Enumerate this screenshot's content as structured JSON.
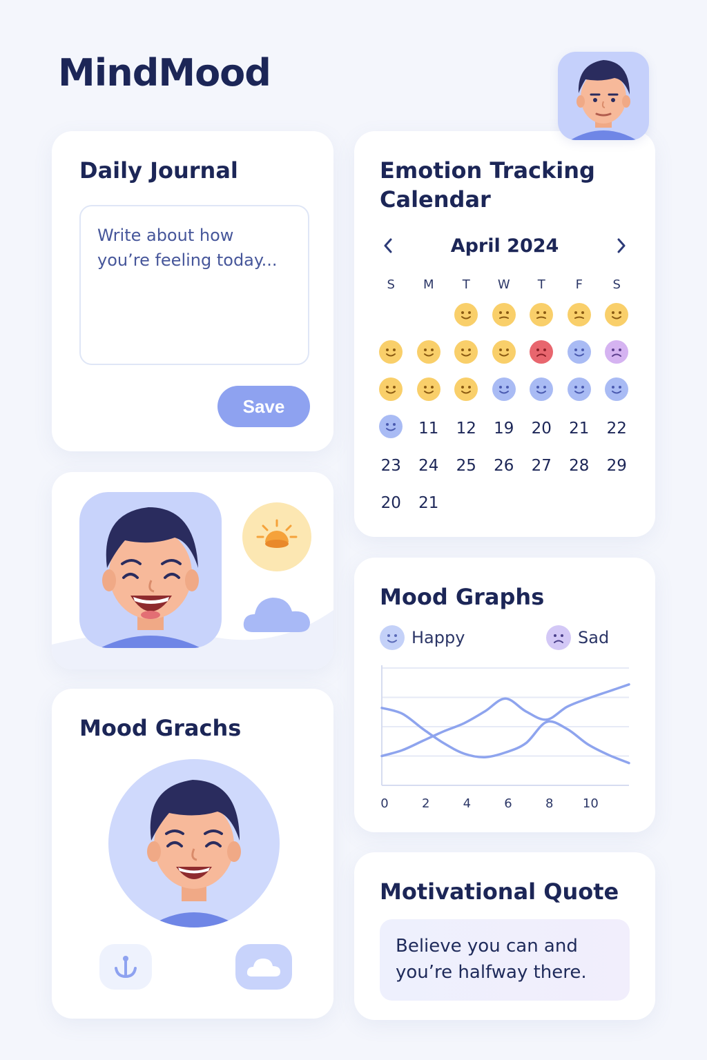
{
  "app": {
    "title": "MindMood"
  },
  "journal": {
    "title": "Daily Journal",
    "placeholder": "Write about how you’re feeling today...",
    "save_label": "Save"
  },
  "mood_grachs": {
    "title": "Mood Grachs"
  },
  "calendar": {
    "title": "Emotion Tracking Calendar",
    "month": "April",
    "year": "2024",
    "weekdays": [
      "S",
      "M",
      "T",
      "W",
      "T",
      "F",
      "S"
    ],
    "days": [
      "11",
      "12",
      "19",
      "20",
      "21",
      "22",
      "23",
      "24",
      "25",
      "26",
      "27",
      "28",
      "29",
      "20",
      "21"
    ],
    "mood_rows": [
      [
        "",
        "",
        "happy",
        "neutral",
        "neutral",
        "neutral",
        "happy"
      ],
      [
        "happy",
        "happy",
        "happy",
        "happy",
        "angry",
        "calm",
        "sad"
      ],
      [
        "happy",
        "happy",
        "happy",
        "calm",
        "calm",
        "calm",
        "calm"
      ]
    ],
    "first_day_mood": "calm",
    "mood_colors": {
      "happy": "#f9cf6a",
      "neutral": "#f9cf6a",
      "angry": "#e8666e",
      "calm": "#a9bbf4",
      "sad": "#d5b3f1"
    }
  },
  "graphs": {
    "title": "Mood Graphs",
    "legend": {
      "happy": "Happy",
      "sad": "Sad"
    }
  },
  "chart_data": {
    "type": "line",
    "x_ticks": [
      "0",
      "2",
      "4",
      "6",
      "8",
      "10"
    ],
    "xlim": [
      0,
      12
    ],
    "ylim": [
      0,
      10
    ],
    "series": [
      {
        "name": "Happy",
        "x": [
          0,
          1,
          2,
          3,
          4,
          5,
          6,
          7,
          8,
          9,
          10,
          11,
          12
        ],
        "values": [
          2.5,
          3.0,
          3.8,
          4.6,
          5.3,
          6.3,
          7.4,
          6.3,
          5.6,
          6.7,
          7.4,
          8.0,
          8.6
        ]
      },
      {
        "name": "Sad",
        "x": [
          0,
          1,
          2,
          3,
          4,
          5,
          6,
          7,
          8,
          9,
          10,
          11,
          12
        ],
        "values": [
          6.6,
          6.1,
          4.8,
          3.6,
          2.7,
          2.4,
          2.8,
          3.6,
          5.4,
          4.8,
          3.5,
          2.6,
          1.9
        ]
      }
    ],
    "line_color": "#8ea4ee",
    "grid": true
  },
  "quote": {
    "title": "Motivational Quote",
    "text": "Believe you can and you’re halfway there."
  }
}
